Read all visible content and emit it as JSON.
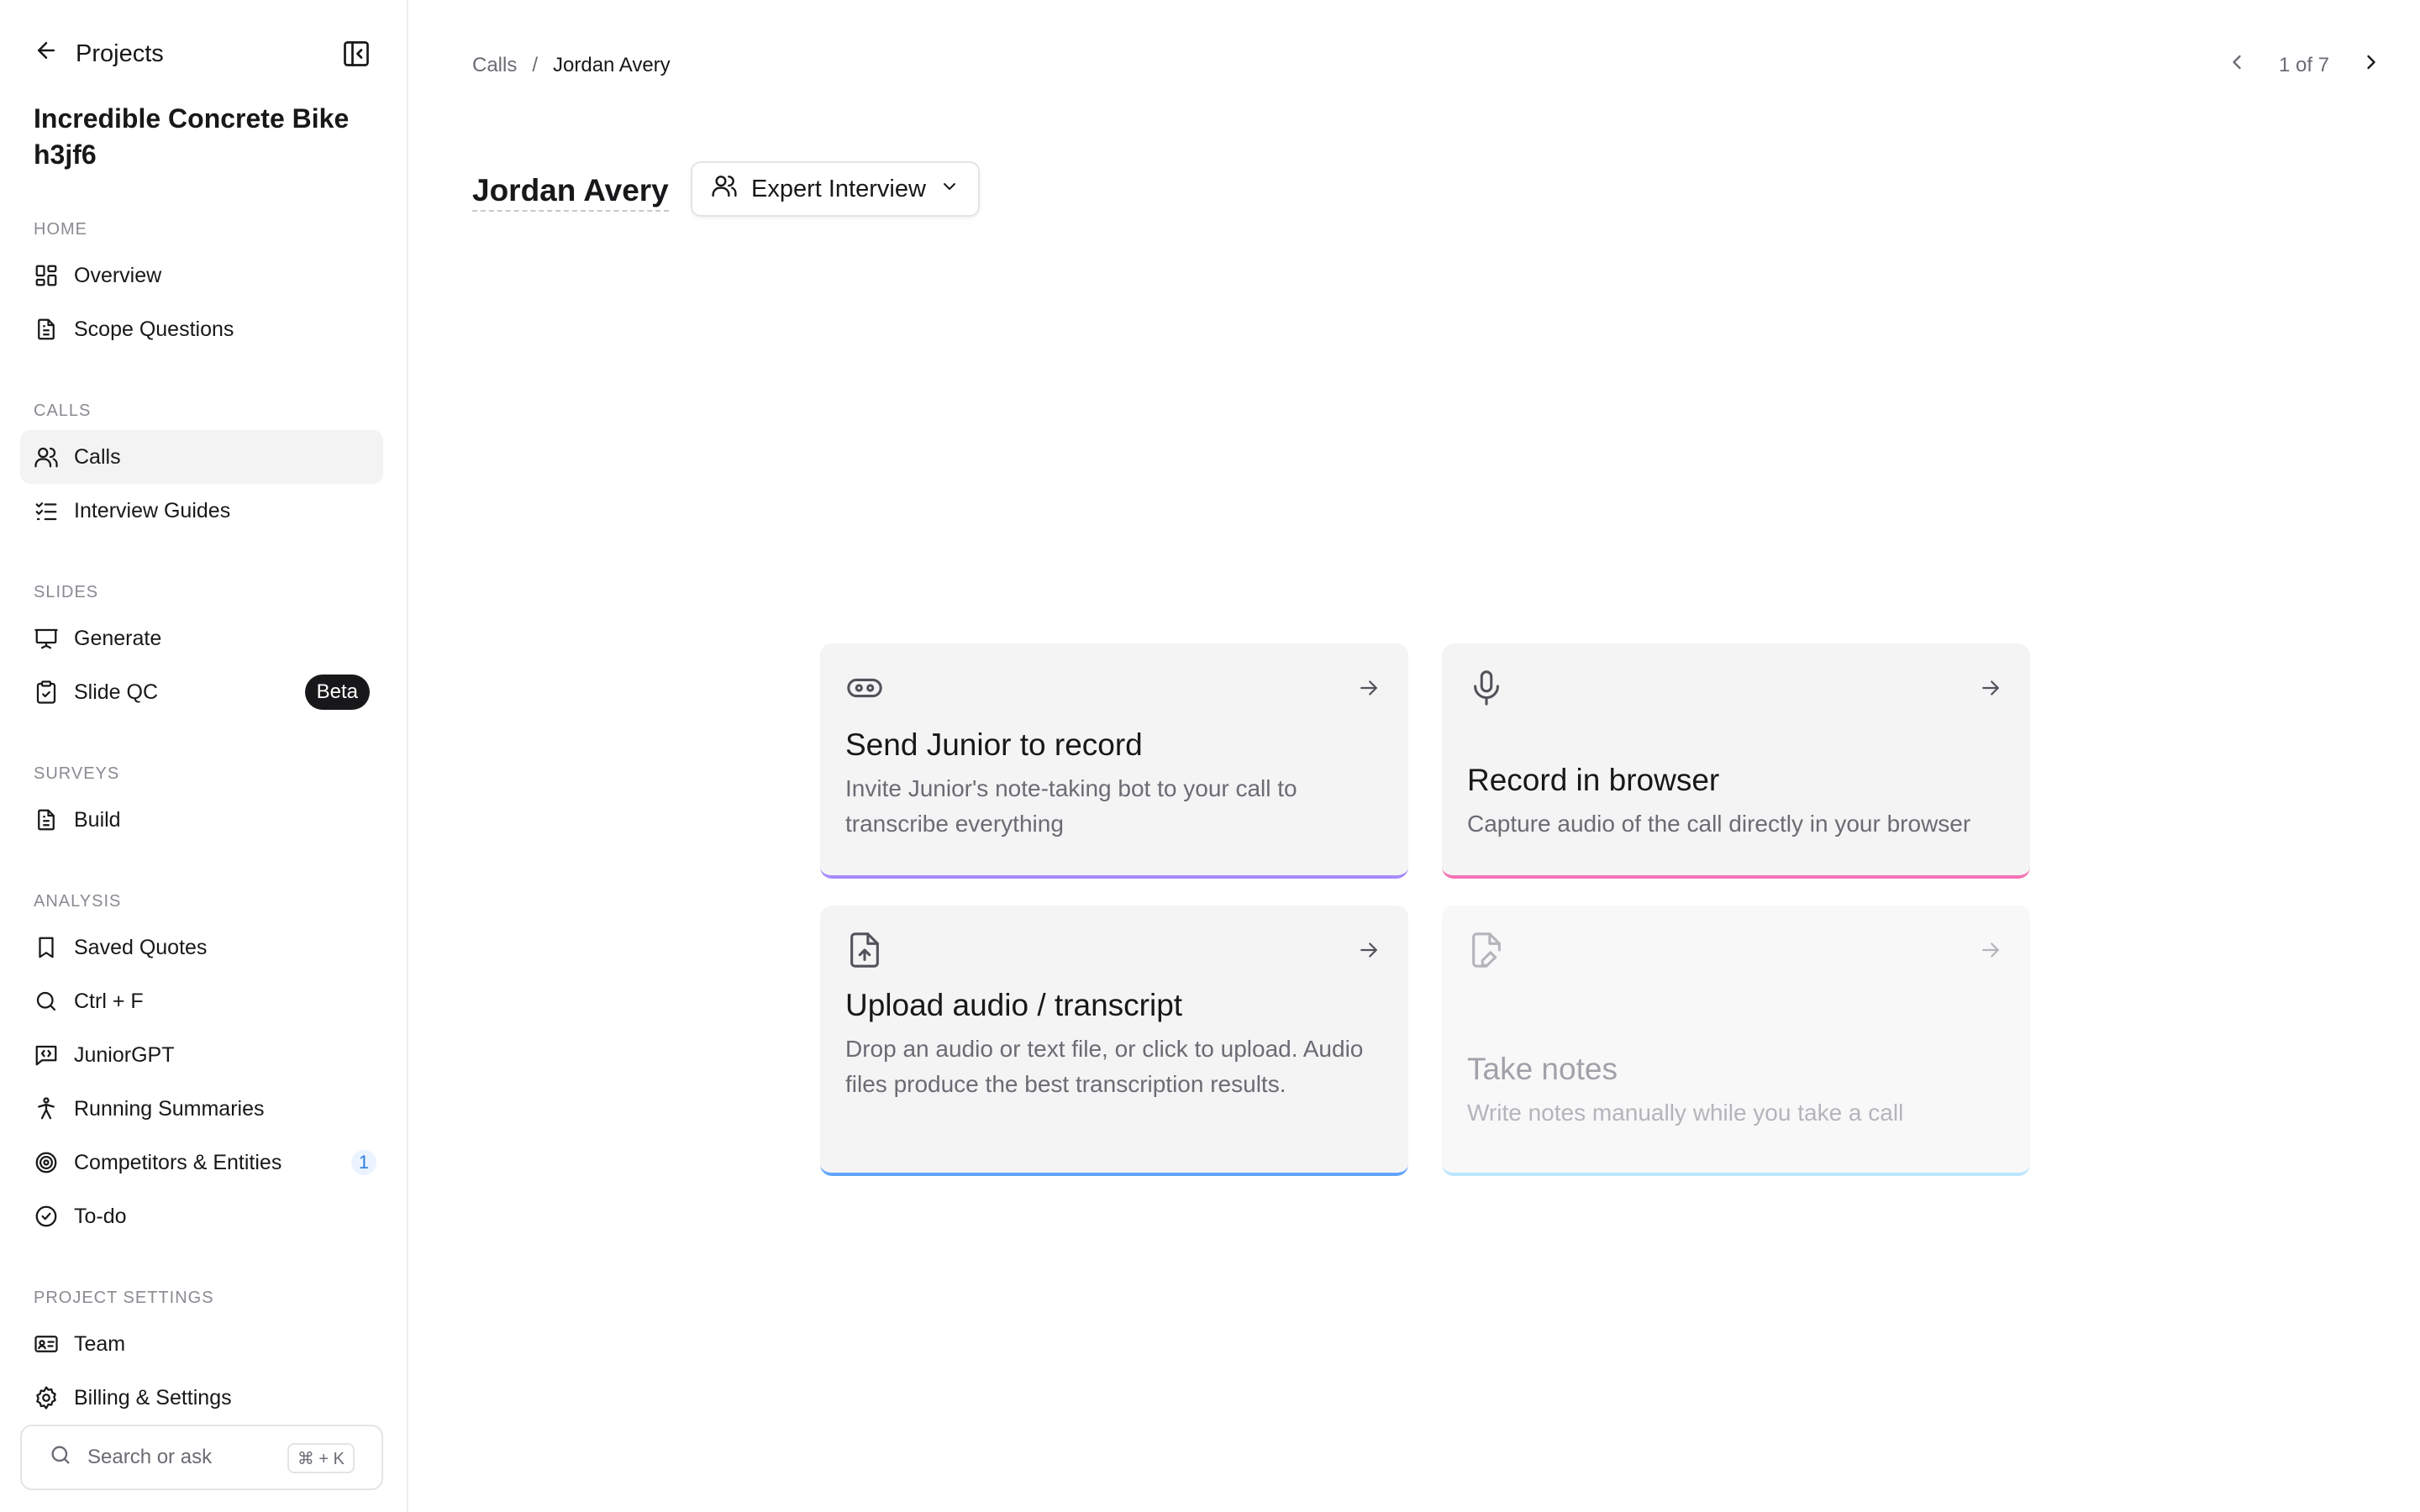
{
  "sidebar": {
    "back_label": "Projects",
    "project_title": "Incredible Concrete Bike h3jf6",
    "sections": {
      "home": "HOME",
      "calls": "CALLS",
      "slides": "SLIDES",
      "surveys": "SURVEYS",
      "analysis": "ANALYSIS",
      "project_settings": "PROJECT SETTINGS"
    },
    "items": {
      "overview": "Overview",
      "scope_questions": "Scope Questions",
      "calls": "Calls",
      "interview_guides": "Interview Guides",
      "generate": "Generate",
      "slide_qc": "Slide QC",
      "slide_qc_badge": "Beta",
      "build": "Build",
      "saved_quotes": "Saved Quotes",
      "ctrl_f": "Ctrl + F",
      "junior_gpt": "JuniorGPT",
      "running_summaries": "Running Summaries",
      "competitors": "Competitors & Entities",
      "competitors_count": "1",
      "todo": "To-do",
      "team": "Team",
      "billing": "Billing & Settings"
    },
    "search": {
      "placeholder": "Search or ask",
      "shortcut": "⌘ + K"
    }
  },
  "header": {
    "breadcrumb": [
      "Calls",
      "/",
      "Jordan Avery"
    ],
    "pager": "1 of 7"
  },
  "call": {
    "name": "Jordan Avery",
    "type": "Expert Interview"
  },
  "cards": {
    "send_junior": {
      "title": "Send Junior to record",
      "desc": "Invite Junior's note-taking bot to your call to transcribe everything",
      "accent": "#a78bfa"
    },
    "record_browser": {
      "title": "Record in browser",
      "desc": "Capture audio of the call directly in your browser",
      "accent": "#f472b6"
    },
    "upload": {
      "title": "Upload audio / transcript",
      "desc": "Drop an audio or text file, or click to upload. Audio files produce the best transcription results.",
      "accent": "#60a5fa"
    },
    "take_notes": {
      "title": "Take notes",
      "desc": "Write notes manually while you take a call",
      "accent": "#bae6fd"
    }
  }
}
